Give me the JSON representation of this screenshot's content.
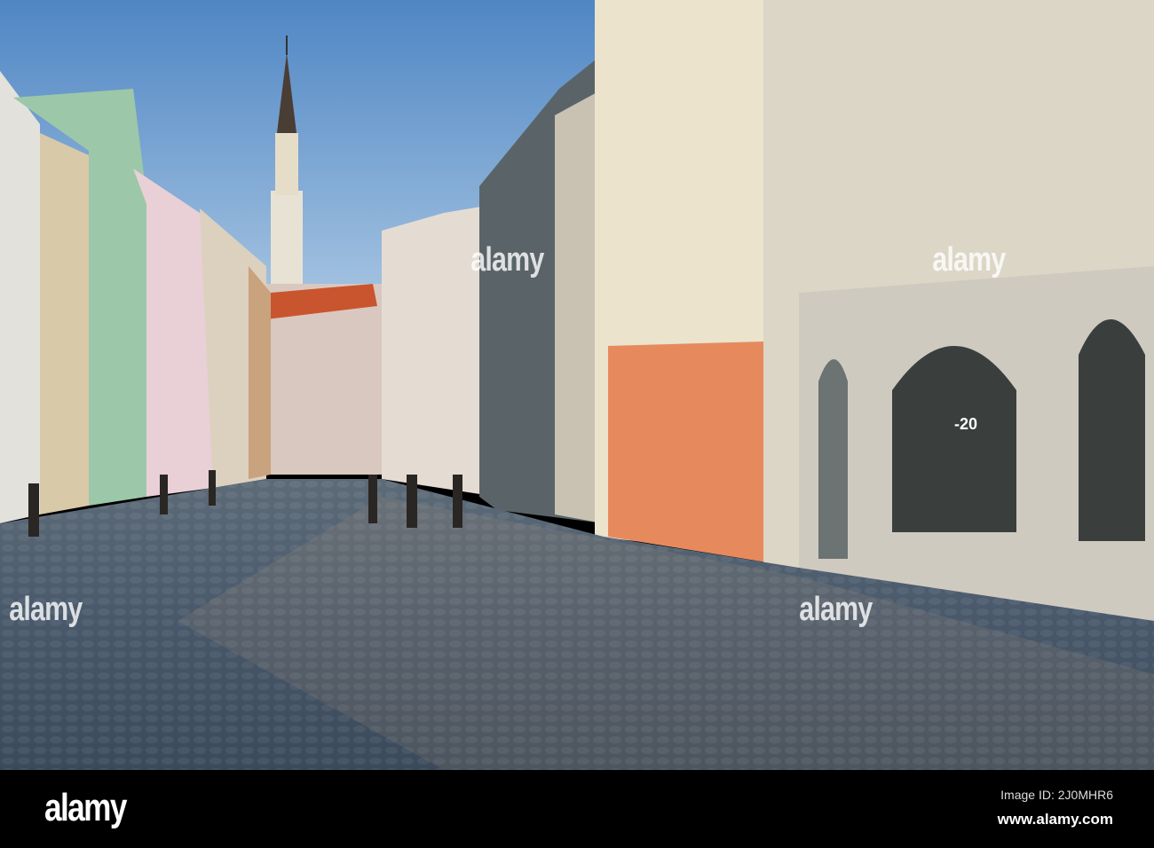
{
  "watermark": {
    "text": "alamy"
  },
  "footer": {
    "logo": "alamy",
    "image_id": "Image ID: 2J0MHR6",
    "url": "www.alamy.com"
  },
  "shop_sign": {
    "text": "-20"
  }
}
